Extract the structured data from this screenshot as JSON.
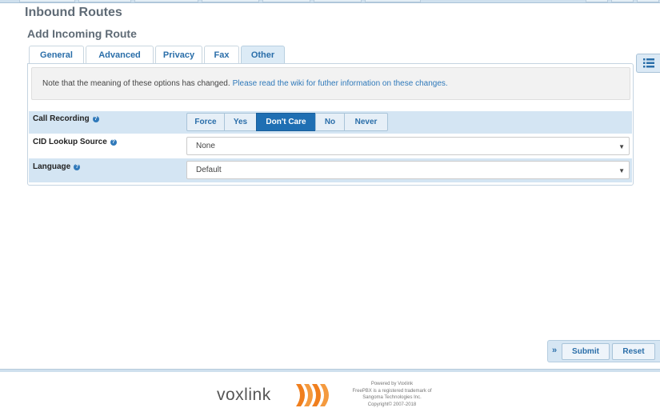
{
  "page": {
    "title": "Inbound Routes",
    "section_title": "Add Incoming Route"
  },
  "tabs": [
    {
      "label": "General"
    },
    {
      "label": "Advanced"
    },
    {
      "label": "Privacy"
    },
    {
      "label": "Fax"
    },
    {
      "label": "Other",
      "active": true
    }
  ],
  "notice": {
    "text": "Note that the meaning of these options has changed.",
    "link_text": "Please read the wiki for futher information on these changes."
  },
  "fields": {
    "call_recording": {
      "label": "Call Recording",
      "options": [
        "Force",
        "Yes",
        "Don't Care",
        "No",
        "Never"
      ],
      "selected": "Don't Care"
    },
    "cid_lookup": {
      "label": "CID Lookup Source",
      "value": "None"
    },
    "language": {
      "label": "Language",
      "value": "Default"
    }
  },
  "actions": {
    "submit_label": "Submit",
    "reset_label": "Reset"
  },
  "footer": {
    "logo_text": "voxlink",
    "powered_by": "Powered by Voxlink",
    "trademark_line1": "FreePBX is a registered trademark of",
    "trademark_line2": "Sangoma Technologies Inc.",
    "copyright": "Copyright© 2007-2018"
  },
  "colors": {
    "accent": "#2f79ba",
    "active_button": "#1f6fb3",
    "row_highlight": "#d4e5f3",
    "logo_orange": "#f07f1e"
  },
  "icons": {
    "help": "question-circle-icon",
    "side_toggle": "list-icon",
    "select_caret": "caret-down-icon",
    "action_expand": "double-chevron-right-icon"
  }
}
